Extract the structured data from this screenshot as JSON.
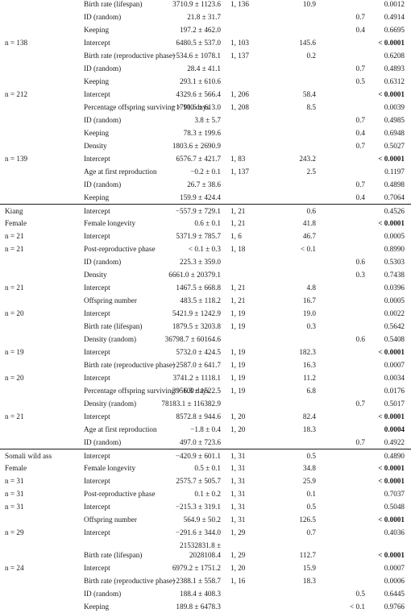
{
  "table": {
    "rows": [
      {
        "group": "",
        "term": "Birth rate (lifespan)",
        "estimate": "3710.9 ± 1123.6",
        "df": "1, 136",
        "F": "10.9",
        "var": "",
        "p": "0.0012",
        "p_bold": false
      },
      {
        "group": "",
        "term": "ID (random)",
        "estimate": "21.8 ± 31.7",
        "df": "",
        "F": "",
        "var": "0.7",
        "p": "0.4914",
        "p_bold": false
      },
      {
        "group": "",
        "term": "Keeping",
        "estimate": "197.2 ± 462.0",
        "df": "",
        "F": "",
        "var": "0.4",
        "p": "0.6695",
        "p_bold": false
      },
      {
        "group": "n = 138",
        "term": "Intercept",
        "estimate": "6480.5 ± 537.0",
        "df": "1, 103",
        "F": "145.6",
        "var": "",
        "p": "< 0.0001",
        "p_bold": true
      },
      {
        "group": "",
        "term": "Birth rate (reproductive phase)",
        "estimate": "−534.6 ± 1078.1",
        "df": "1, 137",
        "F": "0.2",
        "var": "",
        "p": "0.6208",
        "p_bold": false
      },
      {
        "group": "",
        "term": "ID (random)",
        "estimate": "28.4 ± 41.1",
        "df": "",
        "F": "",
        "var": "0.7",
        "p": "0.4893",
        "p_bold": false
      },
      {
        "group": "",
        "term": "Keeping",
        "estimate": "293.1 ± 610.6",
        "df": "",
        "F": "",
        "var": "0.5",
        "p": "0.6312",
        "p_bold": false
      },
      {
        "group": "n = 212",
        "term": "Intercept",
        "estimate": "4329.6 ± 566.4",
        "df": "1, 206",
        "F": "58.4",
        "var": "",
        "p": "< 0.0001",
        "p_bold": true
      },
      {
        "group": "",
        "term": "Percentage offspring surviving > 100 days",
        "estimate": "−1791.6 ± 613.0",
        "df": "1, 208",
        "F": "8.5",
        "var": "",
        "p": "0.0039",
        "p_bold": false
      },
      {
        "group": "",
        "term": "ID (random)",
        "estimate": "3.8 ± 5.7",
        "df": "",
        "F": "",
        "var": "0.7",
        "p": "0.4985",
        "p_bold": false
      },
      {
        "group": "",
        "term": "Keeping",
        "estimate": "78.3 ± 199.6",
        "df": "",
        "F": "",
        "var": "0.4",
        "p": "0.6948",
        "p_bold": false
      },
      {
        "group": "",
        "term": "Density",
        "estimate": "1803.6 ± 2690.9",
        "df": "",
        "F": "",
        "var": "0.7",
        "p": "0.5027",
        "p_bold": false
      },
      {
        "group": "n = 139",
        "term": "Intercept",
        "estimate": "6576.7 ± 421.7",
        "df": "1, 83",
        "F": "243.2",
        "var": "",
        "p": "< 0.0001",
        "p_bold": true
      },
      {
        "group": "",
        "term": "Age at first reproduction",
        "estimate": "−0.2 ± 0.1",
        "df": "1, 137",
        "F": "2.5",
        "var": "",
        "p": "0.1197",
        "p_bold": false
      },
      {
        "group": "",
        "term": "ID (random)",
        "estimate": "26.7 ± 38.6",
        "df": "",
        "F": "",
        "var": "0.7",
        "p": "0.4898",
        "p_bold": false
      },
      {
        "group": "",
        "term": "Keeping",
        "estimate": "159.9 ± 424.4",
        "df": "",
        "F": "",
        "var": "0.4",
        "p": "0.7064",
        "p_bold": false
      },
      {
        "group": "Kiang",
        "term": "Intercept",
        "estimate": "−557.9 ± 729.1",
        "df": "1, 21",
        "F": "0.6",
        "var": "",
        "p": "0.4526",
        "p_bold": false,
        "sep": true
      },
      {
        "group": "Female",
        "term": "Female longevity",
        "estimate": "0.6 ± 0.1",
        "df": "1, 21",
        "F": "41.8",
        "var": "",
        "p": "< 0.0001",
        "p_bold": true
      },
      {
        "group": "n = 21",
        "term": "Intercept",
        "estimate": "5371.9 ± 785.7",
        "df": "1, 6",
        "F": "46.7",
        "var": "",
        "p": "0.0005",
        "p_bold": false
      },
      {
        "group": "n = 21",
        "term": "Post-reproductive phase",
        "estimate": "< 0.1 ± 0.3",
        "df": "1, 18",
        "F": "< 0.1",
        "var": "",
        "p": "0.8990",
        "p_bold": false
      },
      {
        "group": "",
        "term": "ID (random)",
        "estimate": "225.3 ± 359.0",
        "df": "",
        "F": "",
        "var": "0.6",
        "p": "0.5303",
        "p_bold": false
      },
      {
        "group": "",
        "term": "Density",
        "estimate": "6661.0 ± 20379.1",
        "df": "",
        "F": "",
        "var": "0.3",
        "p": "0.7438",
        "p_bold": false
      },
      {
        "group": "n = 21",
        "term": "Intercept",
        "estimate": "1467.5 ± 668.8",
        "df": "1, 21",
        "F": "4.8",
        "var": "",
        "p": "0.0396",
        "p_bold": false
      },
      {
        "group": "",
        "term": "Offspring number",
        "estimate": "483.5 ± 118.2",
        "df": "1, 21",
        "F": "16.7",
        "var": "",
        "p": "0.0005",
        "p_bold": false
      },
      {
        "group": "n = 20",
        "term": "Intercept",
        "estimate": "5421.9 ± 1242.9",
        "df": "1, 19",
        "F": "19.0",
        "var": "",
        "p": "0.0022",
        "p_bold": false
      },
      {
        "group": "",
        "term": "Birth rate (lifespan)",
        "estimate": "1879.5 ± 3203.8",
        "df": "1, 19",
        "F": "0.3",
        "var": "",
        "p": "0.5642",
        "p_bold": false
      },
      {
        "group": "",
        "term": "Density (random)",
        "estimate": "36798.7 ± 60164.6",
        "df": "",
        "F": "",
        "var": "0.6",
        "p": "0.5408",
        "p_bold": false
      },
      {
        "group": "n = 19",
        "term": "Intercept",
        "estimate": "5732.0 ± 424.5",
        "df": "1, 19",
        "F": "182.3",
        "var": "",
        "p": "< 0.0001",
        "p_bold": true
      },
      {
        "group": "",
        "term": "Birth rate (reproductive phase)",
        "estimate": "−2587.0 ± 641.7",
        "df": "1, 19",
        "F": "16.3",
        "var": "",
        "p": "0.0007",
        "p_bold": false
      },
      {
        "group": "n = 20",
        "term": "Intercept",
        "estimate": "3741.2 ± 1118.1",
        "df": "1, 19",
        "F": "11.2",
        "var": "",
        "p": "0.0034",
        "p_bold": false
      },
      {
        "group": "",
        "term": "Percentage offspring surviving > 100 days",
        "estimate": "3956.3 ± 1522.5",
        "df": "1, 19",
        "F": "6.8",
        "var": "",
        "p": "0.0176",
        "p_bold": false
      },
      {
        "group": "",
        "term": "Density (random)",
        "estimate": "78183.1 ± 116382.9",
        "df": "",
        "F": "",
        "var": "0.7",
        "p": "0.5017",
        "p_bold": false
      },
      {
        "group": "n = 21",
        "term": "Intercept",
        "estimate": "8572.8 ± 944.6",
        "df": "1, 20",
        "F": "82.4",
        "var": "",
        "p": "< 0.0001",
        "p_bold": true
      },
      {
        "group": "",
        "term": "Age at first reproduction",
        "estimate": "−1.8 ± 0.4",
        "df": "1, 20",
        "F": "18.3",
        "var": "",
        "p": "0.0004",
        "p_bold": true
      },
      {
        "group": "",
        "term": "ID (random)",
        "estimate": "497.0 ± 723.6",
        "df": "",
        "F": "",
        "var": "0.7",
        "p": "0.4922",
        "p_bold": false
      },
      {
        "group": "Somali wild ass",
        "term": "Intercept",
        "estimate": "−420.9 ± 601.1",
        "df": "1, 31",
        "F": "0.5",
        "var": "",
        "p": "0.4890",
        "p_bold": false,
        "sep": true
      },
      {
        "group": "Female",
        "term": "Female longevity",
        "estimate": "0.5 ± 0.1",
        "df": "1, 31",
        "F": "34.8",
        "var": "",
        "p": "< 0.0001",
        "p_bold": true
      },
      {
        "group": "n = 31",
        "term": "Intercept",
        "estimate": "2575.7 ± 505.7",
        "df": "1, 31",
        "F": "25.9",
        "var": "",
        "p": "< 0.0001",
        "p_bold": true
      },
      {
        "group": "n = 31",
        "term": "Post-reproductive phase",
        "estimate": "0.1 ± 0.2",
        "df": "1, 31",
        "F": "0.1",
        "var": "",
        "p": "0.7037",
        "p_bold": false
      },
      {
        "group": "n = 31",
        "term": "Intercept",
        "estimate": "−215.3 ± 319.1",
        "df": "1, 31",
        "F": "0.5",
        "var": "",
        "p": "0.5048",
        "p_bold": false
      },
      {
        "group": "",
        "term": "Offspring number",
        "estimate": "564.9 ± 50.2",
        "df": "1, 31",
        "F": "126.5",
        "var": "",
        "p": "< 0.0001",
        "p_bold": true
      },
      {
        "group": "n = 29",
        "term": "Intercept",
        "estimate": "−291.6 ± 344.0",
        "df": "1, 29",
        "F": "0.7",
        "var": "",
        "p": "0.4036",
        "p_bold": false
      },
      {
        "group": "",
        "term": "Birth rate (lifespan)",
        "estimate": "21532831.8 ±",
        "estimate2": "2028108.4",
        "df": "1, 29",
        "F": "112.7",
        "var": "",
        "p": "< 0.0001",
        "p_bold": true,
        "tall": true
      },
      {
        "group": "n = 24",
        "term": "Intercept",
        "estimate": "6979.2 ± 1751.2",
        "df": "1, 20",
        "F": "15.9",
        "var": "",
        "p": "0.0007",
        "p_bold": false
      },
      {
        "group": "",
        "term": "Birth rate (reproductive phase)",
        "estimate": "−2388.1 ± 558.7",
        "df": "1, 16",
        "F": "18.3",
        "var": "",
        "p": "0.0006",
        "p_bold": false
      },
      {
        "group": "",
        "term": "ID (random)",
        "estimate": "188.4 ± 408.3",
        "df": "",
        "F": "",
        "var": "0.5",
        "p": "0.6445",
        "p_bold": false
      },
      {
        "group": "",
        "term": "Keeping",
        "estimate": "189.8 ± 6478.3",
        "df": "",
        "F": "",
        "var": "< 0.1",
        "p": "0.9766",
        "p_bold": false
      }
    ]
  }
}
